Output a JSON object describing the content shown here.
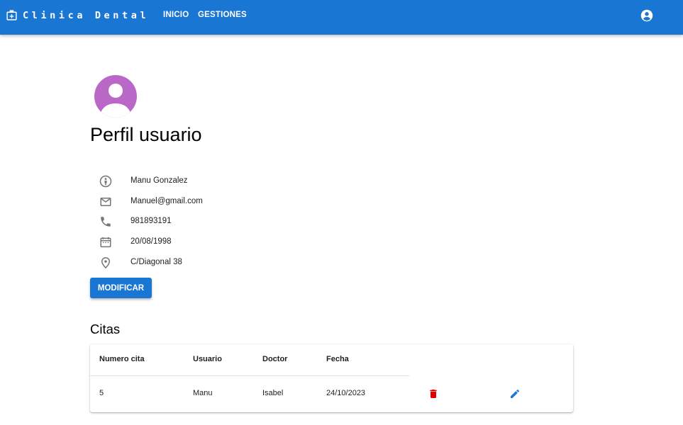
{
  "header": {
    "brand": "Clinica Dental",
    "brand_icon": "medical-bag-icon",
    "nav": [
      "INICIO",
      "GESTIONES"
    ],
    "account_icon": "account-circle-icon",
    "color": "#1976d2"
  },
  "profile": {
    "title": "Perfil usuario",
    "avatar_color": "#ba68c8",
    "fields": [
      {
        "icon": "person-icon",
        "value": "Manu Gonzalez"
      },
      {
        "icon": "email-icon",
        "value": "Manuel@gmail.com"
      },
      {
        "icon": "phone-icon",
        "value": "981893191"
      },
      {
        "icon": "calendar-icon",
        "value": "20/08/1998"
      },
      {
        "icon": "location-icon",
        "value": "C/Diagonal 38"
      }
    ],
    "modify_label": "MODIFICAR"
  },
  "appointments": {
    "title": "Citas",
    "columns": [
      "Numero cita",
      "Usuario",
      "Doctor",
      "Fecha"
    ],
    "rows": [
      {
        "numero": "5",
        "usuario": "Manu",
        "doctor": "Isabel",
        "fecha": "24/10/2023"
      }
    ],
    "delete_color": "#e00000",
    "edit_color": "#1976d2"
  }
}
